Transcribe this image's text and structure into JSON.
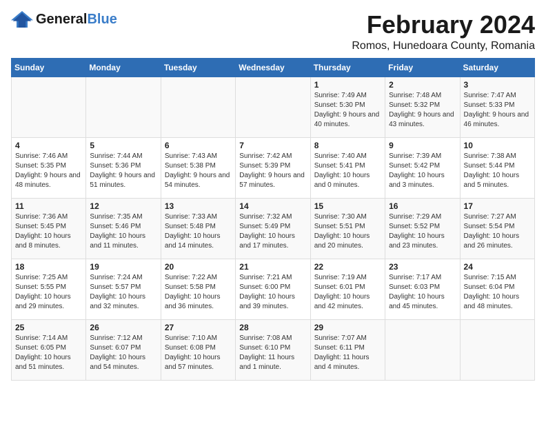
{
  "logo": {
    "brand1": "General",
    "brand2": "Blue",
    "tagline": "Blue"
  },
  "title": "February 2024",
  "subtitle": "Romos, Hunedoara County, Romania",
  "weekdays": [
    "Sunday",
    "Monday",
    "Tuesday",
    "Wednesday",
    "Thursday",
    "Friday",
    "Saturday"
  ],
  "weeks": [
    [
      {
        "day": "",
        "info": ""
      },
      {
        "day": "",
        "info": ""
      },
      {
        "day": "",
        "info": ""
      },
      {
        "day": "",
        "info": ""
      },
      {
        "day": "1",
        "info": "Sunrise: 7:49 AM\nSunset: 5:30 PM\nDaylight: 9 hours\nand 40 minutes."
      },
      {
        "day": "2",
        "info": "Sunrise: 7:48 AM\nSunset: 5:32 PM\nDaylight: 9 hours\nand 43 minutes."
      },
      {
        "day": "3",
        "info": "Sunrise: 7:47 AM\nSunset: 5:33 PM\nDaylight: 9 hours\nand 46 minutes."
      }
    ],
    [
      {
        "day": "4",
        "info": "Sunrise: 7:46 AM\nSunset: 5:35 PM\nDaylight: 9 hours\nand 48 minutes."
      },
      {
        "day": "5",
        "info": "Sunrise: 7:44 AM\nSunset: 5:36 PM\nDaylight: 9 hours\nand 51 minutes."
      },
      {
        "day": "6",
        "info": "Sunrise: 7:43 AM\nSunset: 5:38 PM\nDaylight: 9 hours\nand 54 minutes."
      },
      {
        "day": "7",
        "info": "Sunrise: 7:42 AM\nSunset: 5:39 PM\nDaylight: 9 hours\nand 57 minutes."
      },
      {
        "day": "8",
        "info": "Sunrise: 7:40 AM\nSunset: 5:41 PM\nDaylight: 10 hours\nand 0 minutes."
      },
      {
        "day": "9",
        "info": "Sunrise: 7:39 AM\nSunset: 5:42 PM\nDaylight: 10 hours\nand 3 minutes."
      },
      {
        "day": "10",
        "info": "Sunrise: 7:38 AM\nSunset: 5:44 PM\nDaylight: 10 hours\nand 5 minutes."
      }
    ],
    [
      {
        "day": "11",
        "info": "Sunrise: 7:36 AM\nSunset: 5:45 PM\nDaylight: 10 hours\nand 8 minutes."
      },
      {
        "day": "12",
        "info": "Sunrise: 7:35 AM\nSunset: 5:46 PM\nDaylight: 10 hours\nand 11 minutes."
      },
      {
        "day": "13",
        "info": "Sunrise: 7:33 AM\nSunset: 5:48 PM\nDaylight: 10 hours\nand 14 minutes."
      },
      {
        "day": "14",
        "info": "Sunrise: 7:32 AM\nSunset: 5:49 PM\nDaylight: 10 hours\nand 17 minutes."
      },
      {
        "day": "15",
        "info": "Sunrise: 7:30 AM\nSunset: 5:51 PM\nDaylight: 10 hours\nand 20 minutes."
      },
      {
        "day": "16",
        "info": "Sunrise: 7:29 AM\nSunset: 5:52 PM\nDaylight: 10 hours\nand 23 minutes."
      },
      {
        "day": "17",
        "info": "Sunrise: 7:27 AM\nSunset: 5:54 PM\nDaylight: 10 hours\nand 26 minutes."
      }
    ],
    [
      {
        "day": "18",
        "info": "Sunrise: 7:25 AM\nSunset: 5:55 PM\nDaylight: 10 hours\nand 29 minutes."
      },
      {
        "day": "19",
        "info": "Sunrise: 7:24 AM\nSunset: 5:57 PM\nDaylight: 10 hours\nand 32 minutes."
      },
      {
        "day": "20",
        "info": "Sunrise: 7:22 AM\nSunset: 5:58 PM\nDaylight: 10 hours\nand 36 minutes."
      },
      {
        "day": "21",
        "info": "Sunrise: 7:21 AM\nSunset: 6:00 PM\nDaylight: 10 hours\nand 39 minutes."
      },
      {
        "day": "22",
        "info": "Sunrise: 7:19 AM\nSunset: 6:01 PM\nDaylight: 10 hours\nand 42 minutes."
      },
      {
        "day": "23",
        "info": "Sunrise: 7:17 AM\nSunset: 6:03 PM\nDaylight: 10 hours\nand 45 minutes."
      },
      {
        "day": "24",
        "info": "Sunrise: 7:15 AM\nSunset: 6:04 PM\nDaylight: 10 hours\nand 48 minutes."
      }
    ],
    [
      {
        "day": "25",
        "info": "Sunrise: 7:14 AM\nSunset: 6:05 PM\nDaylight: 10 hours\nand 51 minutes."
      },
      {
        "day": "26",
        "info": "Sunrise: 7:12 AM\nSunset: 6:07 PM\nDaylight: 10 hours\nand 54 minutes."
      },
      {
        "day": "27",
        "info": "Sunrise: 7:10 AM\nSunset: 6:08 PM\nDaylight: 10 hours\nand 57 minutes."
      },
      {
        "day": "28",
        "info": "Sunrise: 7:08 AM\nSunset: 6:10 PM\nDaylight: 11 hours\nand 1 minute."
      },
      {
        "day": "29",
        "info": "Sunrise: 7:07 AM\nSunset: 6:11 PM\nDaylight: 11 hours\nand 4 minutes."
      },
      {
        "day": "",
        "info": ""
      },
      {
        "day": "",
        "info": ""
      }
    ]
  ]
}
